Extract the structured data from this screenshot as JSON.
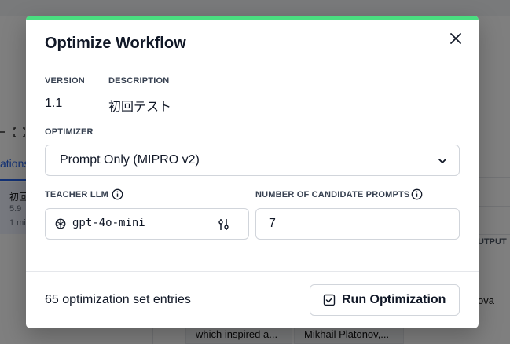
{
  "background": {
    "tab_label": "ations",
    "row_title": "初回",
    "row_sub": "5.9",
    "row_sub2": "1 mi",
    "output_header": "UTPUT",
    "side_text": "ova",
    "cell_1": "which inspired a...",
    "cell_2": "Mikhail Platonov,..."
  },
  "modal": {
    "title": "Optimize Workflow",
    "version_label": "VERSION",
    "version_value": "1.1",
    "description_label": "DESCRIPTION",
    "description_value": "初回テスト",
    "optimizer_label": "OPTIMIZER",
    "optimizer_value": "Prompt Only (MIPRO v2)",
    "teacher_label": "TEACHER LLM",
    "teacher_value": "gpt-4o-mini",
    "candidates_label": "NUMBER OF CANDIDATE PROMPTS",
    "candidates_value": "7",
    "entries_text": "65 optimization set entries",
    "run_label": "Run Optimization"
  },
  "icons": [
    "close-icon",
    "chevron-down-icon",
    "info-icon",
    "openai-icon",
    "model-settings-icon",
    "checkbox-icon",
    "expand-icon"
  ],
  "colors": {
    "accent": "#4ade80",
    "overlay": "rgba(0,0,0,0.5)",
    "text": "#111827",
    "border": "#d1d5db"
  }
}
